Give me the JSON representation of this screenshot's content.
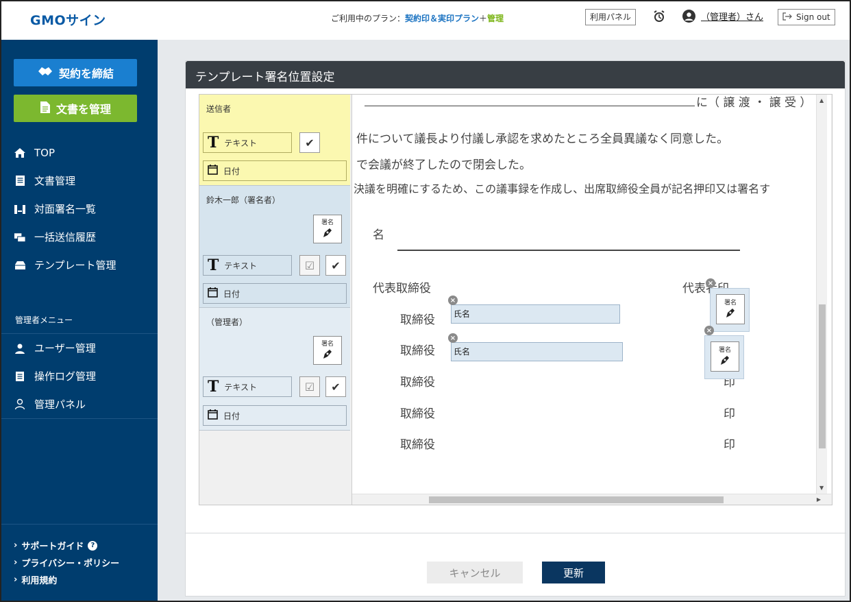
{
  "header": {
    "logo": "GMOサイン",
    "plan_prefix": "ご利用中のプラン：",
    "plan_name": "契約印＆実印プラン",
    "plan_plus": "＋",
    "plan_addon": "管理",
    "panel_button": "利用パネル",
    "user_name": "（管理者）さん",
    "signout": "Sign out"
  },
  "sidebar": {
    "contract_button": "契約を締結",
    "docs_button": "文書を管理",
    "items": [
      {
        "label": "TOP",
        "icon": "home-icon"
      },
      {
        "label": "文書管理",
        "icon": "document-list-icon"
      },
      {
        "label": "対面署名一覧",
        "icon": "face-to-face-icon"
      },
      {
        "label": "一括送信履歴",
        "icon": "bulk-send-icon"
      },
      {
        "label": "テンプレート管理",
        "icon": "template-icon"
      }
    ],
    "admin_title": "管理者メニュー",
    "admin_items": [
      {
        "label": "ユーザー管理",
        "icon": "user-icon"
      },
      {
        "label": "操作ログ管理",
        "icon": "log-icon"
      },
      {
        "label": "管理パネル",
        "icon": "admin-panel-icon"
      }
    ],
    "footer": [
      "サポートガイド",
      "プライバシー・ポリシー",
      "利用規約"
    ]
  },
  "page": {
    "title": "テンプレート署名位置設定",
    "cancel": "キャンセル",
    "update": "更新"
  },
  "fields": {
    "sender": {
      "title": "送信者",
      "text": "テキスト",
      "date": "日付"
    },
    "signer1": {
      "title": "鈴木一郎（署名者）",
      "sign": "署名",
      "text": "テキスト",
      "date": "日付"
    },
    "signer2": {
      "title": "（管理者）",
      "sign": "署名",
      "text": "テキスト",
      "date": "日付"
    }
  },
  "document": {
    "line1_suffix": "に（ 譲 渡 ・ 譲 受 ）",
    "line2": "件について議長より付議し承認を求めたところ全員異議なく同意した。",
    "line3": "で会議が終了したので閉会した。",
    "line4": "決議を明確にするため、この議事録を作成し、出席取締役全員が記名押印又は署名す",
    "name_label": "名",
    "rep_left": "代表取締役",
    "rep_right": "代表者印",
    "director": "取締役",
    "seal": "印",
    "placed_name_1": "氏名",
    "placed_name_2": "氏名",
    "placed_sign": "署名"
  }
}
